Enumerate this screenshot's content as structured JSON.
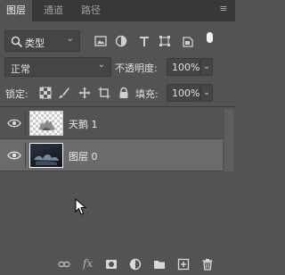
{
  "tabs": [
    {
      "label": "图层",
      "active": true
    },
    {
      "label": "通道",
      "active": false
    },
    {
      "label": "路径",
      "active": false
    }
  ],
  "tab_menu_icon": "menu-icon",
  "filter": {
    "kind_label": "类型",
    "icons": [
      "image-filter-icon",
      "adjustment-filter-icon",
      "type-filter-icon",
      "shape-filter-icon",
      "smart-object-filter-icon"
    ]
  },
  "blend": {
    "mode": "正常",
    "opacity_label": "不透明度:",
    "opacity_value": "100%"
  },
  "lock": {
    "label": "锁定:",
    "icons": [
      "lock-transparent-icon",
      "lock-pixels-icon",
      "lock-position-icon",
      "lock-artboard-icon",
      "lock-all-icon"
    ],
    "fill_label": "填充:",
    "fill_value": "100%"
  },
  "layers": [
    {
      "name": "天鹅 1",
      "visible": true,
      "selected": false,
      "thumb": "transparent"
    },
    {
      "name": "图层 0",
      "visible": true,
      "selected": true,
      "thumb": "photo"
    }
  ],
  "bottom_icons": [
    "link-icon",
    "fx-icon",
    "mask-icon",
    "adjustment-layer-icon",
    "group-folder-icon",
    "new-layer-icon",
    "trash-icon"
  ],
  "bottom_fx_label": "fx",
  "colors": {
    "panel_bg": "#535353",
    "tab_bar_bg": "#383838",
    "selected_layer_bg": "#6b6b6b"
  }
}
